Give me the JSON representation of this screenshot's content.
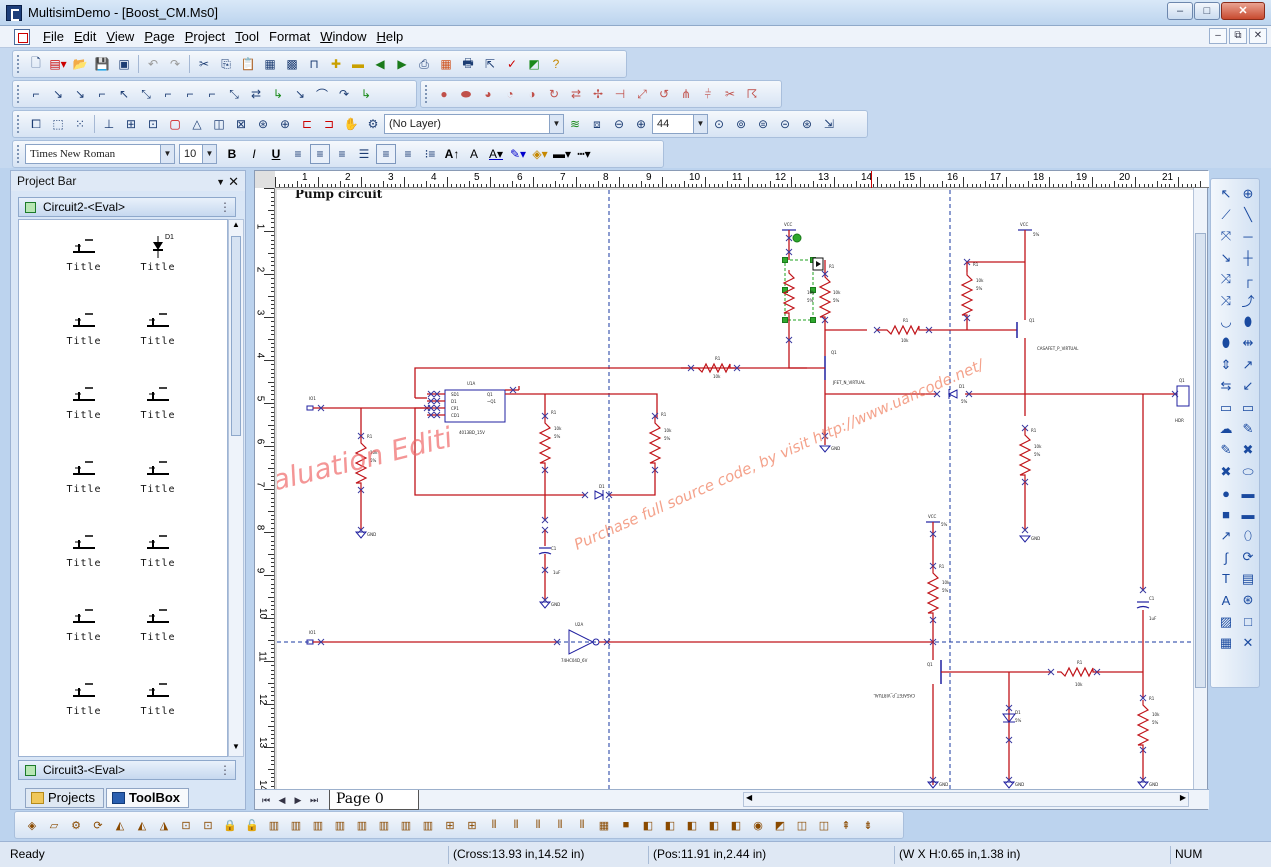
{
  "window": {
    "title": "MultisimDemo - [Boost_CM.Ms0]",
    "minimize": "–",
    "restore": "□",
    "close": "✕"
  },
  "menu": {
    "items": [
      {
        "key": "F",
        "rest": "ile"
      },
      {
        "key": "E",
        "rest": "dit"
      },
      {
        "key": "V",
        "rest": "iew"
      },
      {
        "key": "P",
        "rest": "age"
      },
      {
        "key": "P",
        "rest": "roject"
      },
      {
        "key": "T",
        "rest": "ool"
      },
      {
        "key": "",
        "rest": "Format"
      },
      {
        "key": "W",
        "rest": "indow"
      },
      {
        "key": "H",
        "rest": "elp"
      }
    ]
  },
  "toolbar": {
    "layer_value": "(No Layer)",
    "zoom_value": "44",
    "font_name": "Times New Roman",
    "font_size": "10",
    "bold": "B",
    "italic": "I",
    "underline": "U"
  },
  "project_bar": {
    "title": "Project Bar",
    "circuit_top": "Circuit2-<Eval>",
    "circuit_bottom": "Circuit3-<Eval>",
    "palette_label": "Title",
    "palette_symbols": [
      "D1"
    ],
    "tabs": {
      "projects": "Projects",
      "toolbox": "ToolBox"
    }
  },
  "canvas": {
    "sheet_title": "Pump circuit",
    "page_tab": "Page  0",
    "ruler_top": [
      "1",
      "2",
      "3",
      "4",
      "5",
      "6",
      "7",
      "8",
      "9",
      "10",
      "11",
      "12",
      "13",
      "14",
      "15",
      "16",
      "17",
      "18",
      "19",
      "20",
      "21"
    ],
    "ruler_left": [
      "1",
      "2",
      "3",
      "4",
      "5",
      "6",
      "7",
      "8",
      "9",
      "10",
      "11",
      "12",
      "13",
      "14"
    ],
    "watermark_1": "aluation Editi",
    "watermark_2": "Purchase full source code, by visit http://www.uancode.net/",
    "labels": {
      "vcc": "VCC",
      "gnd": "GND",
      "r": "R1",
      "ohm": "10k",
      "pct": "5%",
      "cap": "C1",
      "cap_val": "1uF",
      "ic": "U1A",
      "ic_name": "4013BD_15V",
      "ic_pins": [
        "SD1",
        "D1",
        "CP1",
        "CD1",
        "Q1",
        "~Q1"
      ],
      "jfet": "JFET_N_VIRTUAL",
      "mosfet": "CASAFET_P_VIRTUAL",
      "mosfet2": "CASAFET_P_VIRTUAL",
      "buffer": "U2A",
      "buffer_name": "74HC04D_6V",
      "diode": "D1",
      "q": "Q1",
      "port": "IO1",
      "cut": "HDR"
    }
  },
  "status": {
    "ready": "Ready",
    "cross": "(Cross:13.93 in,14.52 in)",
    "pos": "(Pos:11.91 in,2.44 in)",
    "size": "(W X H:0.65 in,1.38 in)",
    "num": "NUM"
  }
}
